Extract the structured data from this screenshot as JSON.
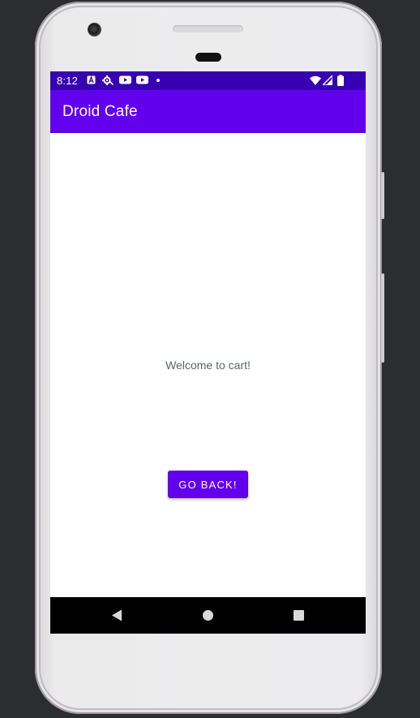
{
  "status_bar": {
    "time": "8:12",
    "left_icons": [
      "a-accessibility-icon",
      "settings-debug-icon",
      "youtube-icon",
      "youtube-icon",
      "dot-icon"
    ],
    "right_icons": [
      "wifi-icon",
      "cell-signal-icon",
      "battery-icon"
    ],
    "color": "#3700b3"
  },
  "app_bar": {
    "title": "Droid Cafe",
    "color": "#6200ee"
  },
  "content": {
    "welcome_text": "Welcome to cart!",
    "go_back_label": "GO BACK!"
  },
  "nav_bar": {
    "buttons": [
      "back-icon",
      "home-icon",
      "recents-icon"
    ]
  }
}
